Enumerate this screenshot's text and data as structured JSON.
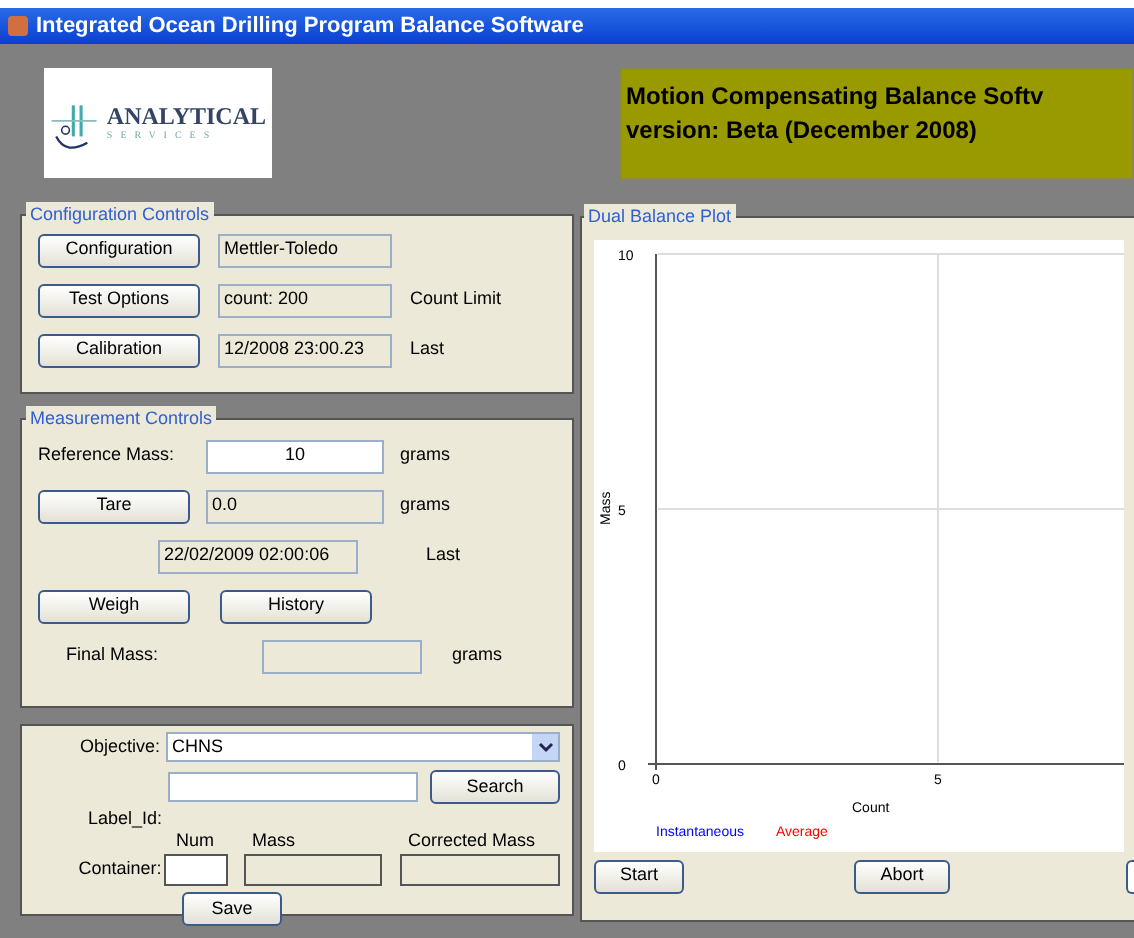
{
  "window": {
    "title": "Integrated Ocean Drilling Program Balance Software"
  },
  "logo": {
    "title": "ANALYTICAL",
    "subtitle": "SERVICES"
  },
  "banner": {
    "lines": [
      "Motion Compensating Balance Softv",
      "version: Beta (December 2008)"
    ]
  },
  "configuration_controls": {
    "title": "Configuration Controls",
    "rows": [
      {
        "button": "Configuration",
        "value": "Mettler-Toledo"
      },
      {
        "button": "Test Options",
        "value": "count: 200",
        "note": "Count Limit"
      },
      {
        "button": "Calibration",
        "value": "12/2008 23:00.23",
        "note": "Last"
      }
    ]
  },
  "measurement_controls": {
    "title": "Measurement Controls",
    "reference_mass": {
      "label": "Reference Mass:",
      "value": "10",
      "unit": "grams"
    },
    "tare": {
      "button": "Tare",
      "value": "0.0",
      "unit": "grams"
    },
    "last": {
      "value": "22/02/2009 02:00:06",
      "label": "Last"
    },
    "buttons": [
      "Weigh",
      "History"
    ],
    "final_mass": {
      "label": "Final Mass:",
      "unit": "grams"
    }
  },
  "objective_panel": {
    "objective": {
      "label": "Objective:",
      "value": "CHNS"
    },
    "search_button": "Search",
    "label_id": "Label_Id:",
    "columns": [
      "Num",
      "Mass",
      "Corrected Mass"
    ],
    "container_label": "Container:",
    "save_button": "Save"
  },
  "plot": {
    "title": "Dual Balance Plot",
    "chart_data": {
      "type": "line",
      "xlabel": "Count",
      "ylabel": "Mass",
      "ylim": [
        0,
        10
      ],
      "yticks": [
        0,
        5,
        10
      ],
      "categories": [
        "0",
        "5"
      ],
      "series": [
        {
          "name": "Instantaneous",
          "color": "#0000ff",
          "values": [
            null,
            null
          ]
        },
        {
          "name": "Average",
          "color": "#ff0000",
          "values": [
            null,
            null
          ]
        }
      ]
    },
    "buttons": [
      "Start",
      "Abort"
    ]
  }
}
